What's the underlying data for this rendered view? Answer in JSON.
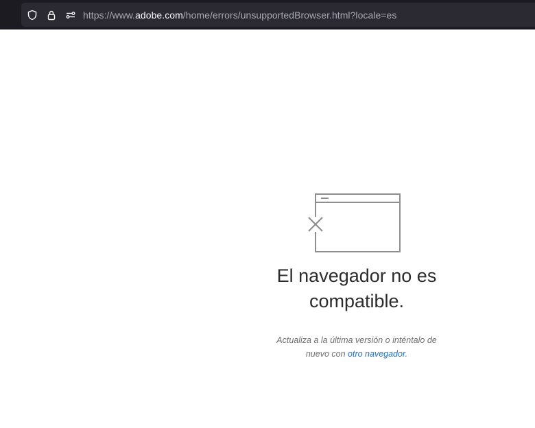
{
  "browser": {
    "url_prefix": "https://www.",
    "url_host": "adobe.com",
    "url_path": "/home/errors/unsupportedBrowser.html?locale=es",
    "icons": [
      "shield-icon",
      "lock-icon",
      "permissions-icon"
    ]
  },
  "error": {
    "title": "El navegador no es compatible.",
    "message_before": "Actualiza a la última versión o inténtalo de nuevo con ",
    "link_text": "otro navegador",
    "message_after": "."
  },
  "colors": {
    "chrome_bg": "#1c1b22",
    "urlbar_bg": "#2b2a33",
    "link": "#1473e6",
    "illustration": "#8e8e8e"
  }
}
